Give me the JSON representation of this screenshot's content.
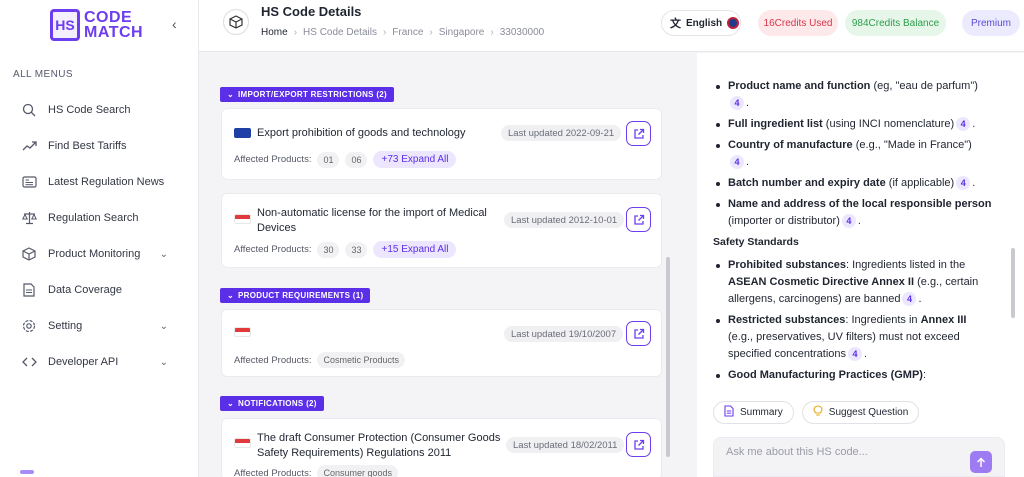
{
  "brand": {
    "mark": "HS",
    "line1": "CODE",
    "line2": "MATCH"
  },
  "sidebar": {
    "heading": "ALL MENUS",
    "items": [
      {
        "label": "HS Code Search",
        "icon": "search-icon"
      },
      {
        "label": "Find Best Tariffs",
        "icon": "trend-icon"
      },
      {
        "label": "Latest Regulation News",
        "icon": "news-icon"
      },
      {
        "label": "Regulation Search",
        "icon": "scale-icon"
      },
      {
        "label": "Product Monitoring",
        "icon": "box-icon",
        "has_submenu": true
      },
      {
        "label": "Data Coverage",
        "icon": "document-icon"
      },
      {
        "label": "Setting",
        "icon": "gear-icon",
        "has_submenu": true
      },
      {
        "label": "Developer API",
        "icon": "code-icon",
        "has_submenu": true
      }
    ]
  },
  "header": {
    "title": "HS Code Details",
    "breadcrumb": [
      "Home",
      "HS Code Details",
      "France",
      "Singapore",
      "33030000"
    ],
    "language": "English",
    "credits_used": "16Credits Used",
    "credits_balance": "984Credits Balance",
    "plan": "Premium"
  },
  "sections": {
    "import_export": {
      "label": "IMPORT/EXPORT RESTRICTIONS (2)",
      "cards": [
        {
          "flag": "EU",
          "title": "Export prohibition of goods and technology",
          "updated": "Last updated 2022-09-21",
          "affected_label": "Affected Products:",
          "chips": [
            "01",
            "06"
          ],
          "expand": "+73 Expand All"
        },
        {
          "flag": "Singapore",
          "title": "Non-automatic license for the import of Medical Devices",
          "updated": "Last updated 2012-10-01",
          "affected_label": "Affected Products:",
          "chips": [
            "30",
            "33"
          ],
          "expand": "+15 Expand All"
        }
      ]
    },
    "product_requirements": {
      "label": "PRODUCT REQUIREMENTS (1)",
      "cards": [
        {
          "flag": "Singapore",
          "title": "",
          "updated": "Last updated 19/10/2007",
          "affected_label": "Affected Products:",
          "chips": [
            "Cosmetic Products"
          ]
        }
      ]
    },
    "notifications": {
      "label": "NOTIFICATIONS (2)",
      "cards": [
        {
          "flag": "Singapore",
          "title": "The draft Consumer Protection (Consumer Goods Safety Requirements) Regulations 2011",
          "updated": "Last updated 18/02/2011",
          "affected_label": "Affected Products:",
          "chips": [
            "Consumer goods"
          ]
        }
      ]
    }
  },
  "chat": {
    "labeling": [
      {
        "bold": "Product name and function",
        "rest": " (eg, \"eau de parfum\")",
        "cite": "4",
        "tail": "."
      },
      {
        "bold": "Full ingredient list",
        "rest": " (using INCI nomenclature)",
        "cite": "4",
        "tail": "."
      },
      {
        "bold": "Country of manufacture",
        "rest": " (e.g., \"Made in France\")",
        "cite": "4",
        "tail": "."
      },
      {
        "bold": "Batch number and expiry date",
        "rest": " (if applicable)",
        "cite": "4",
        "tail": "."
      },
      {
        "bold": "Name and address of the local responsible person",
        "rest": " (importer or distributor)",
        "cite": "4",
        "tail": "."
      }
    ],
    "safety_heading": "Safety Standards",
    "safety": [
      {
        "bold": "Prohibited substances",
        "rest": ": Ingredients listed in the ",
        "bold2": "ASEAN Cosmetic Directive Annex II",
        "rest2": " (e.g., certain allergens, carcinogens) are banned",
        "cite": "4",
        "tail": "."
      },
      {
        "bold": "Restricted substances",
        "rest": ": Ingredients in ",
        "bold2": "Annex III",
        "rest2": " (e.g., preservatives, UV filters) must not exceed specified concentrations",
        "cite": "4",
        "tail": "."
      },
      {
        "bold": "Good Manufacturing Practices (GMP)",
        "rest": ":",
        "bold2": "",
        "rest2": "",
        "cite": "",
        "tail": ""
      }
    ],
    "summary_button": "Summary",
    "suggest_button": "Suggest Question",
    "input_placeholder": "Ask me about this HS code..."
  }
}
